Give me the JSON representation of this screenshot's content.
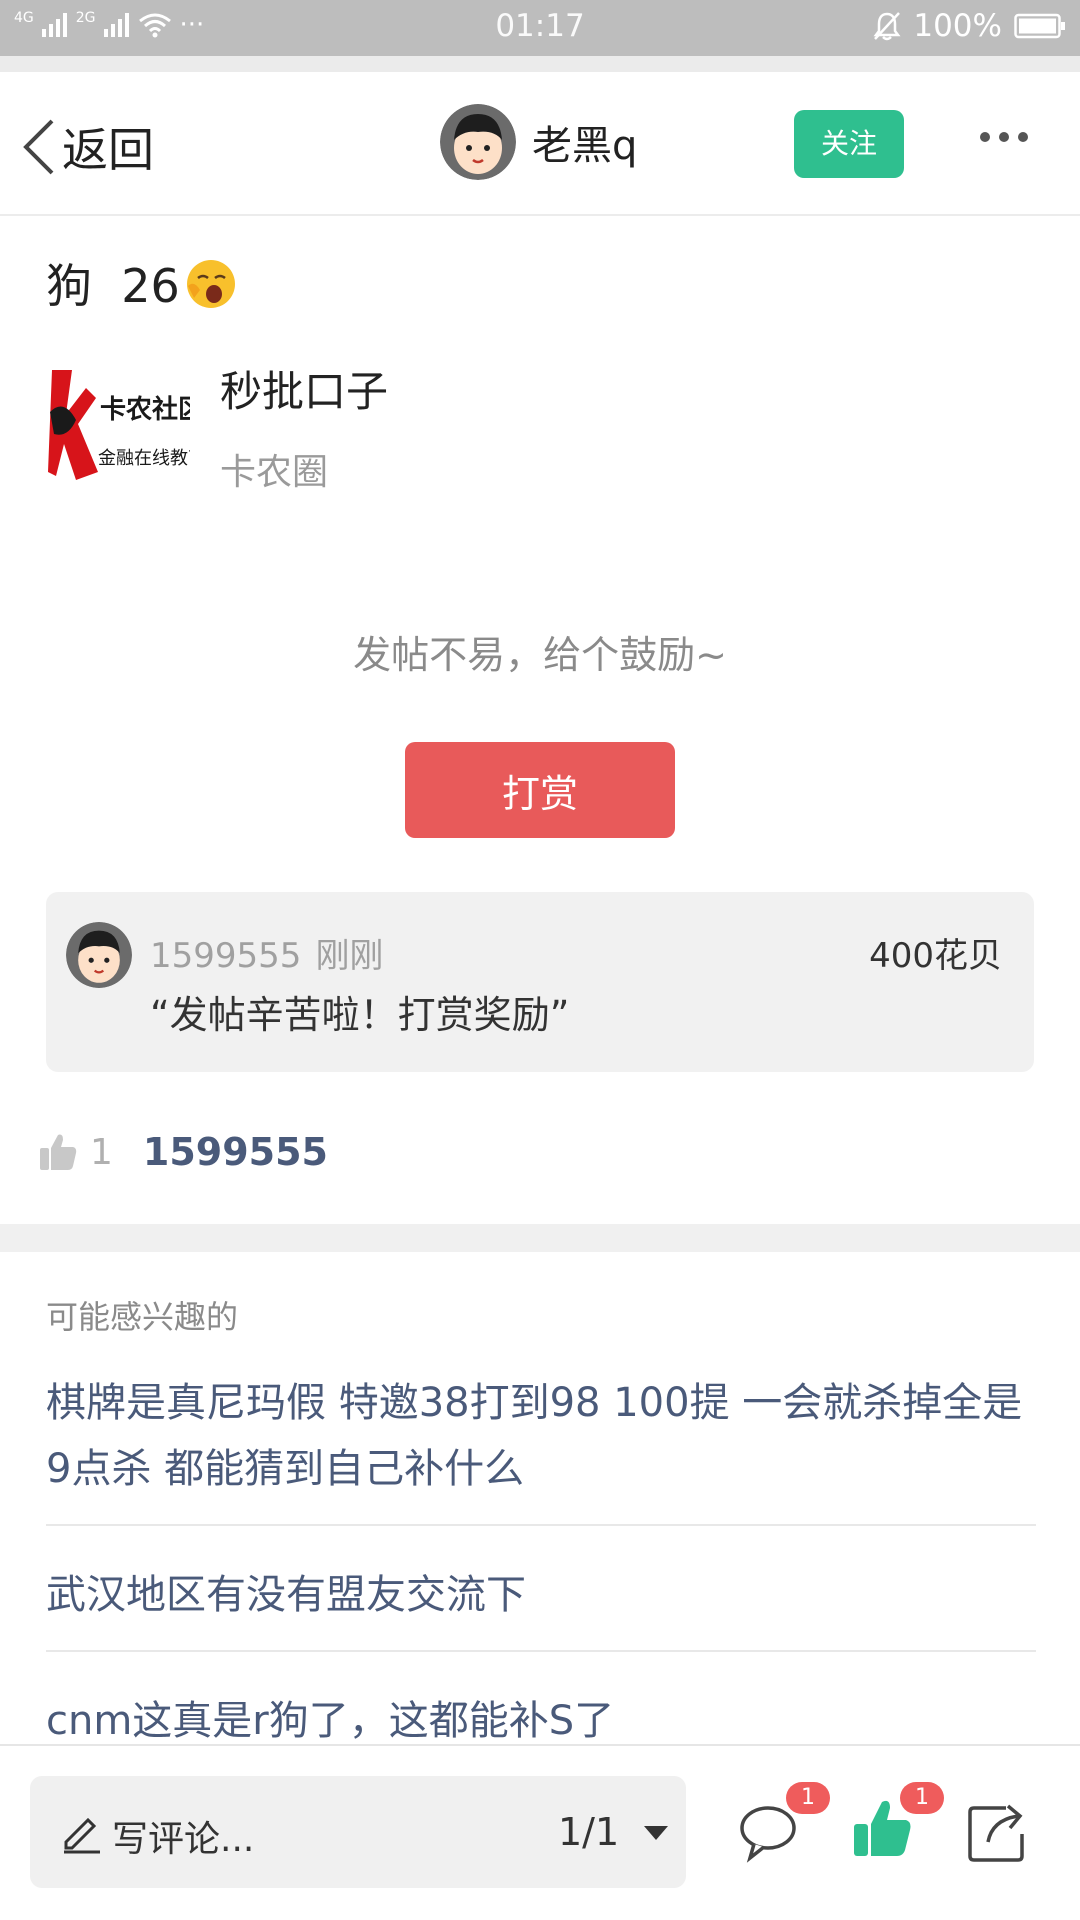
{
  "status_bar": {
    "net1": "4G",
    "net2": "2G",
    "dots": "···",
    "time": "01:17",
    "battery": "100%"
  },
  "nav": {
    "back_label": "返回",
    "author_name": "老黑q",
    "follow_label": "关注"
  },
  "post": {
    "title_text": "狗  26",
    "circle_name": "秒批口子",
    "circle_sub": "卡农圈",
    "circle_logo_text": "卡农社区 金融在线教育"
  },
  "reward": {
    "hint": "发帖不易，给个鼓励~",
    "button_label": "打赏",
    "entry": {
      "user": "1599555",
      "time": "刚刚",
      "amount": "400花贝",
      "message": "“发帖辛苦啦！打赏奖励”"
    }
  },
  "likes": {
    "count": "1",
    "users": "1599555"
  },
  "related": {
    "title": "可能感兴趣的",
    "items": [
      "棋牌是真尼玛假 特邀38打到98 100提 一会就杀掉全是9点杀 都能猜到自己补什么",
      "武汉地区有没有盟友交流下",
      "cnm这真是r狗了，这都能补S了"
    ]
  },
  "bottom_bar": {
    "comment_placeholder": "写评论...",
    "page_indicator": "1/1",
    "comment_badge": "1",
    "like_badge": "1"
  },
  "colors": {
    "accent_green": "#2fbf8f",
    "reward_red": "#e85a5a",
    "link_blue": "#4a5a7a",
    "badge_red": "#ef5c5c"
  },
  "icons": [
    "signal-icon",
    "wifi-icon",
    "mute-bell-icon",
    "battery-icon",
    "back-chevron-icon",
    "more-icon",
    "sleep-emoji-icon",
    "pencil-icon",
    "dropdown-caret-icon",
    "comment-icon",
    "thumbs-up-icon",
    "share-icon"
  ]
}
